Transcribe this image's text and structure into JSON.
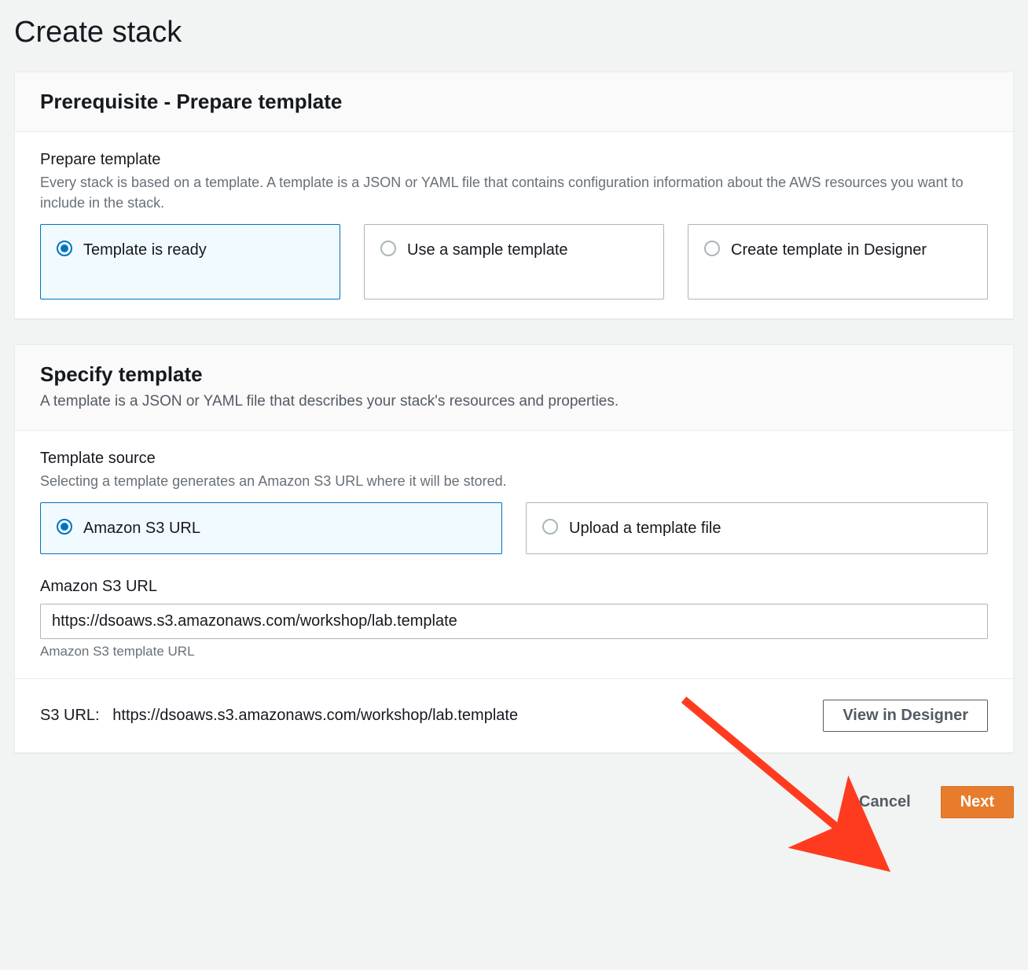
{
  "page": {
    "title": "Create stack"
  },
  "prereq": {
    "header": "Prerequisite - Prepare template",
    "field_label": "Prepare template",
    "field_help": "Every stack is based on a template. A template is a JSON or YAML file that contains configuration information about the AWS resources you want to include in the stack.",
    "options": [
      {
        "label": "Template is ready",
        "selected": true
      },
      {
        "label": "Use a sample template",
        "selected": false
      },
      {
        "label": "Create template in Designer",
        "selected": false
      }
    ]
  },
  "specify": {
    "header": "Specify template",
    "subtitle": "A template is a JSON or YAML file that describes your stack's resources and properties.",
    "source_label": "Template source",
    "source_help": "Selecting a template generates an Amazon S3 URL where it will be stored.",
    "source_options": [
      {
        "label": "Amazon S3 URL",
        "selected": true
      },
      {
        "label": "Upload a template file",
        "selected": false
      }
    ],
    "url_label": "Amazon S3 URL",
    "url_value": "https://dsoaws.s3.amazonaws.com/workshop/lab.template",
    "url_hint": "Amazon S3 template URL",
    "s3_row_prefix": "S3 URL:",
    "s3_row_value": "https://dsoaws.s3.amazonaws.com/workshop/lab.template",
    "view_designer": "View in Designer"
  },
  "footer": {
    "cancel": "Cancel",
    "next": "Next"
  },
  "annotation": {
    "arrow_color": "#ff3b1f"
  }
}
